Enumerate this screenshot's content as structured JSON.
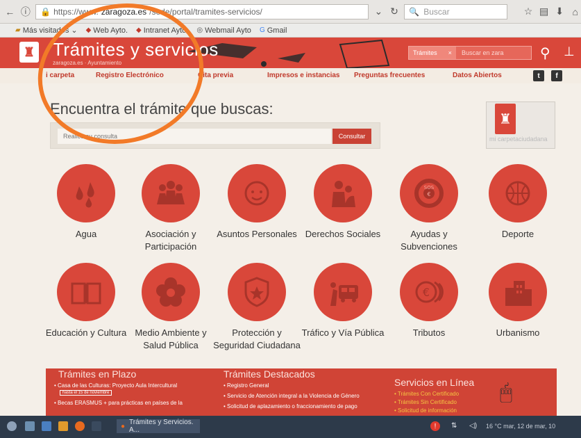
{
  "browser": {
    "url_scheme": "https://www.",
    "url_host": "zaragoza.es",
    "url_path": "/sede/portal/tramites-servicios/",
    "search_placeholder": "Buscar",
    "bookmarks": [
      {
        "label": "Más visitados"
      },
      {
        "label": "Web Ayto."
      },
      {
        "label": "Intranet Ayto."
      },
      {
        "label": "Webmail Ayto"
      },
      {
        "label": "Gmail"
      }
    ]
  },
  "header": {
    "title": "Trámites y servicios",
    "breadcrumb": "zaragoza.es · Ayuntamiento",
    "search_tag": "Trámites",
    "search_tag_close": "×",
    "search_placeholder": "Buscar en zara",
    "brand_color": "#d9473a"
  },
  "nav": {
    "items": [
      {
        "label": "i carpeta"
      },
      {
        "label": "Registro Electrónico"
      },
      {
        "label": "Cita previa"
      },
      {
        "label": "Impresos e instancias"
      },
      {
        "label": "Preguntas frecuentes"
      },
      {
        "label": "Datos Abiertos"
      }
    ],
    "twitter": "t",
    "facebook": "f"
  },
  "main": {
    "heading": "Encuentra el trámite que buscas:",
    "query_placeholder": "Realice su consulta",
    "query_button": "Consultar",
    "carpeta_label": "mi carpetaciudadana"
  },
  "categories": [
    {
      "label": "Agua",
      "icon": "drops-icon"
    },
    {
      "label": "Asociación y Participación",
      "icon": "people-icon"
    },
    {
      "label": "Asuntos Personales",
      "icon": "face-icon"
    },
    {
      "label": "Derechos Sociales",
      "icon": "embrace-icon"
    },
    {
      "label": "Ayudas y Subvenciones",
      "icon": "lifebuoy-icon"
    },
    {
      "label": "Deporte",
      "icon": "ball-icon"
    },
    {
      "label": "Educación y Cultura",
      "icon": "book-icon"
    },
    {
      "label": "Medio Ambiente y Salud Pública",
      "icon": "flower-icon"
    },
    {
      "label": "Protección y Seguridad Ciudadana",
      "icon": "shield-icon"
    },
    {
      "label": "Tráfico y Vía Pública",
      "icon": "bus-icon"
    },
    {
      "label": "Tributos",
      "icon": "euro-coins-icon"
    },
    {
      "label": "Urbanismo",
      "icon": "buildings-icon"
    }
  ],
  "bands": {
    "plazo": {
      "title": "Trámites en Plazo",
      "items": [
        "Casa de las Culturas: Proyecto Aula Intercultural",
        "Becas ERASMUS + para prácticas en países de la"
      ],
      "badge": "hasta el 15 de noviembre"
    },
    "destacados": {
      "title": "Trámites Destacados",
      "items": [
        "Registro General",
        "Servicio de Atención integral a la Violencia de Género",
        "Solicitud de aplazamiento o fraccionamiento de pago"
      ]
    },
    "linea": {
      "title": "Servicios en Línea",
      "items": [
        "Trámites Con Certificado",
        "Trámites Sin Certificado",
        "Solicitud de información"
      ]
    }
  },
  "taskbar": {
    "task_label": "Trámites y Servicios. A...",
    "clock": "16 °C  mar, 12 de mar, 10",
    "alert": "!"
  }
}
